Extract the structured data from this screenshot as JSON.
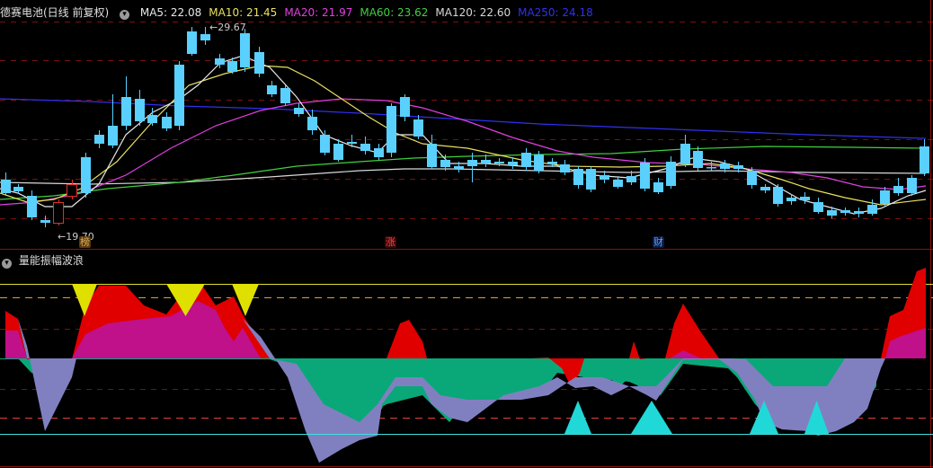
{
  "header": {
    "title": "德赛电池(日线 前复权)",
    "indicators": [
      {
        "label": "MA5: 22.08",
        "color": "#e8e8e8"
      },
      {
        "label": "MA10: 21.45",
        "color": "#e8e060"
      },
      {
        "label": "MA20: 21.97",
        "color": "#e040e0"
      },
      {
        "label": "MA60: 23.62",
        "color": "#40d040"
      },
      {
        "label": "MA120: 22.60",
        "color": "#d8d8d8"
      },
      {
        "label": "MA250: 24.18",
        "color": "#3030f0"
      }
    ]
  },
  "price_labels": {
    "high": "29.67",
    "low": "19.70"
  },
  "badges": [
    {
      "text": "榜",
      "color": "#d8b060",
      "bg": "#5a3a10"
    },
    {
      "text": "涨",
      "color": "#ff4040",
      "bg": "#3a0808"
    },
    {
      "text": "财",
      "color": "#60a0ff",
      "bg": "#0a1a40"
    }
  ],
  "sub_panel": {
    "title": "量能振幅波浪"
  },
  "colors": {
    "up": "#e03030",
    "down": "#5ad0ff",
    "grid": "#7a1010",
    "red_fill": "#e00000",
    "magenta_fill": "#c0108a",
    "green_fill": "#0aa878",
    "lavender_fill": "#8080c0",
    "yellow_tri": "#e0e000",
    "cyan_tri": "#20d8d8"
  }
}
